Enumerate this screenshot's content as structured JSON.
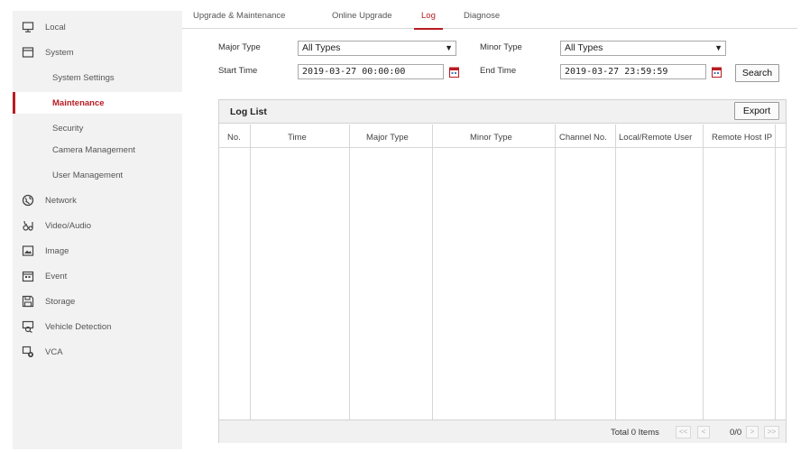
{
  "sidebar": {
    "items": [
      {
        "label": "Local",
        "icon": "monitor-icon"
      },
      {
        "label": "System",
        "icon": "system-icon"
      },
      {
        "label": "System Settings"
      },
      {
        "label": "Maintenance",
        "active": true
      },
      {
        "label": "Security"
      },
      {
        "label": "Camera Management"
      },
      {
        "label": "User Management"
      },
      {
        "label": "Network",
        "icon": "globe-icon"
      },
      {
        "label": "Video/Audio",
        "icon": "video-audio-icon"
      },
      {
        "label": "Image",
        "icon": "image-icon"
      },
      {
        "label": "Event",
        "icon": "calendar-icon"
      },
      {
        "label": "Storage",
        "icon": "save-disk-icon"
      },
      {
        "label": "Vehicle Detection",
        "icon": "vehicle-detection-icon"
      },
      {
        "label": "VCA",
        "icon": "vca-icon"
      }
    ]
  },
  "tabs": [
    {
      "label": "Upgrade & Maintenance"
    },
    {
      "label": "Online Upgrade"
    },
    {
      "label": "Log",
      "active": true
    },
    {
      "label": "Diagnose"
    }
  ],
  "filters": {
    "major_type_label": "Major Type",
    "major_type_value": "All Types",
    "minor_type_label": "Minor Type",
    "minor_type_value": "All Types",
    "start_time_label": "Start Time",
    "start_time_value": "2019-03-27 00:00:00",
    "end_time_label": "End Time",
    "end_time_value": "2019-03-27 23:59:59",
    "search_label": "Search"
  },
  "log_list": {
    "title": "Log List",
    "export_label": "Export",
    "columns": [
      "No.",
      "Time",
      "Major Type",
      "Minor Type",
      "Channel No.",
      "Local/Remote User",
      "Remote Host IP"
    ],
    "rows": [],
    "total_label": "Total 0 Items",
    "page_info": "0/0",
    "pager": {
      "first": "<<",
      "prev": "<",
      "next": ">",
      "last": ">>"
    }
  },
  "colors": {
    "accent": "#b81c22",
    "sidebar_bg": "#f2f2f2"
  }
}
